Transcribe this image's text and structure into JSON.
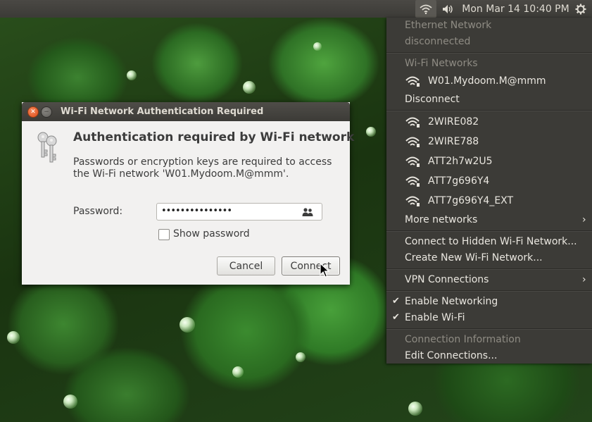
{
  "top_panel": {
    "clock": "Mon Mar 14 10:40 PM",
    "icons": [
      "wifi-icon",
      "volume-icon",
      "gear-icon"
    ]
  },
  "network_menu": {
    "ethernet_header": "Ethernet Network",
    "ethernet_status": "disconnected",
    "wifi_header": "Wi-Fi Networks",
    "connected_network": "W01.Mydoom.M@mmm",
    "disconnect_label": "Disconnect",
    "networks": [
      "2WIRE082",
      "2WIRE788",
      "ATT2h7w2U5",
      "ATT7g696Y4",
      "ATT7g696Y4_EXT"
    ],
    "more_networks": "More networks",
    "connect_hidden": "Connect to Hidden Wi-Fi Network...",
    "create_new": "Create New Wi-Fi Network...",
    "vpn_connections": "VPN Connections",
    "enable_networking": "Enable Networking",
    "enable_wifi": "Enable Wi-Fi",
    "connection_information": "Connection Information",
    "edit_connections": "Edit Connections..."
  },
  "dialog": {
    "title": "Wi-Fi Network Authentication Required",
    "heading": "Authentication required by Wi-Fi network",
    "message": "Passwords or encryption keys are required to access the Wi-Fi network 'W01.Mydoom.M@mmm'.",
    "password_label": "Password:",
    "password_value": "•••••••••••••••",
    "show_password_label": "Show password",
    "show_password_checked": false,
    "cancel_label": "Cancel",
    "connect_label": "Connect"
  },
  "colors": {
    "panel": "#3c3b37",
    "menu_text": "#e9e6df",
    "menu_dim_text": "#8e8b83",
    "dialog_bg": "#f2f1f0",
    "close_button": "#df4b16"
  }
}
